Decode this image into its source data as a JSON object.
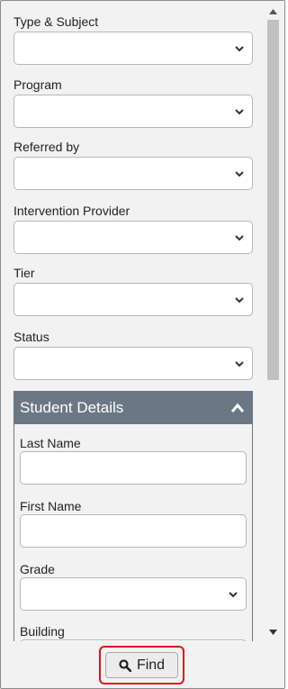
{
  "filters": [
    {
      "label": "Type & Subject",
      "value": ""
    },
    {
      "label": "Program",
      "value": ""
    },
    {
      "label": "Referred by",
      "value": ""
    },
    {
      "label": "Intervention Provider",
      "value": ""
    },
    {
      "label": "Tier",
      "value": ""
    },
    {
      "label": "Status",
      "value": ""
    }
  ],
  "student_details": {
    "title": "Student Details",
    "collapse_icon": "chevron-up-icon",
    "last_name": {
      "label": "Last Name",
      "value": ""
    },
    "first_name": {
      "label": "First Name",
      "value": ""
    },
    "grade": {
      "label": "Grade",
      "value": ""
    },
    "building": {
      "label": "Building",
      "value": ""
    }
  },
  "find_button": {
    "label": "Find",
    "icon": "search-icon"
  },
  "colors": {
    "section_header": "#6b7884",
    "highlight": "#e0141e",
    "panel_bg": "#f2f2f2"
  }
}
